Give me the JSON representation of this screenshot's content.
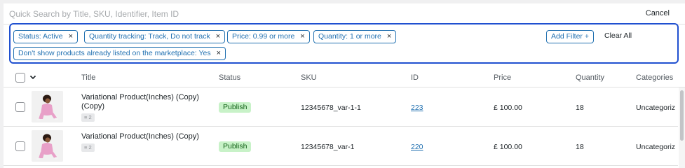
{
  "search": {
    "placeholder": "Quick Search by Title, SKU, Identifier, Item ID",
    "value": "",
    "cancel_label": "Cancel"
  },
  "filters": {
    "chips": [
      "Status: Active",
      "Quantity tracking: Track, Do not track",
      "Price: 0.99 or more",
      "Quantity: 1 or more",
      "Don't show products already listed on the marketplace: Yes"
    ],
    "remove_glyph": "×",
    "add_filter_label": "Add Filter",
    "add_filter_glyph": "+",
    "clear_all_label": "Clear All",
    "active_border_color": "#2050d0"
  },
  "table": {
    "headers": {
      "title": "Title",
      "status": "Status",
      "sku": "SKU",
      "id": "ID",
      "price": "Price",
      "quantity": "Quantity",
      "categories": "Categories"
    },
    "rows": [
      {
        "title": "Variational Product(Inches) (Copy) (Copy)",
        "variation_count": "2",
        "status": "Publish",
        "sku": "12345678_var-1-1",
        "id": "223",
        "price": "£ 100.00",
        "quantity": "18",
        "categories": "Uncategoriz"
      },
      {
        "title": "Variational Product(Inches) (Copy)",
        "variation_count": "2",
        "status": "Publish",
        "sku": "12345678_var-1",
        "id": "220",
        "price": "£ 100.00",
        "quantity": "18",
        "categories": "Uncategoriz"
      }
    ]
  },
  "colors": {
    "link": "#2271b1",
    "status_bg": "#c8f2c8",
    "status_text": "#0f5f14",
    "thumb_figure": "#e8a0c8"
  },
  "icons": {
    "chevron": "chevron-down-icon",
    "remove": "close-icon",
    "variations": "list-icon",
    "thumbnail": "product-image"
  }
}
